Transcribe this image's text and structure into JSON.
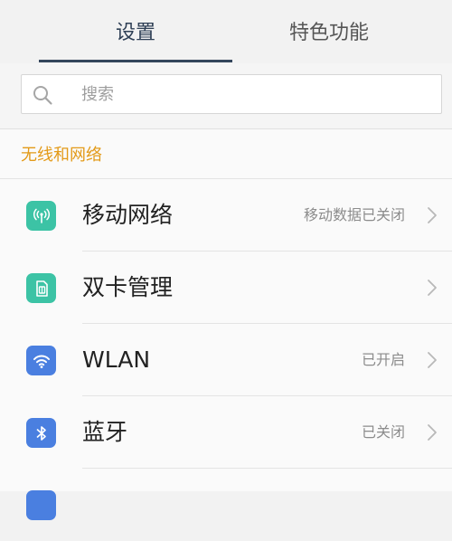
{
  "tabs": [
    {
      "label": "设置",
      "active": true
    },
    {
      "label": "特色功能",
      "active": false
    }
  ],
  "search": {
    "placeholder": "搜索",
    "value": ""
  },
  "section": {
    "title": "无线和网络"
  },
  "items": [
    {
      "label": "移动网络",
      "status": "移动数据已关闭",
      "icon": "mobile-network-icon",
      "color": "#3cc3a5"
    },
    {
      "label": "双卡管理",
      "status": "",
      "icon": "sim-card-icon",
      "color": "#3cc3a5"
    },
    {
      "label": "WLAN",
      "status": "已开启",
      "icon": "wifi-icon",
      "color": "#4a7fe0"
    },
    {
      "label": "蓝牙",
      "status": "已关闭",
      "icon": "bluetooth-icon",
      "color": "#4a7fe0"
    }
  ],
  "colors": {
    "accent": "#34465c",
    "section_title": "#e39a18"
  }
}
